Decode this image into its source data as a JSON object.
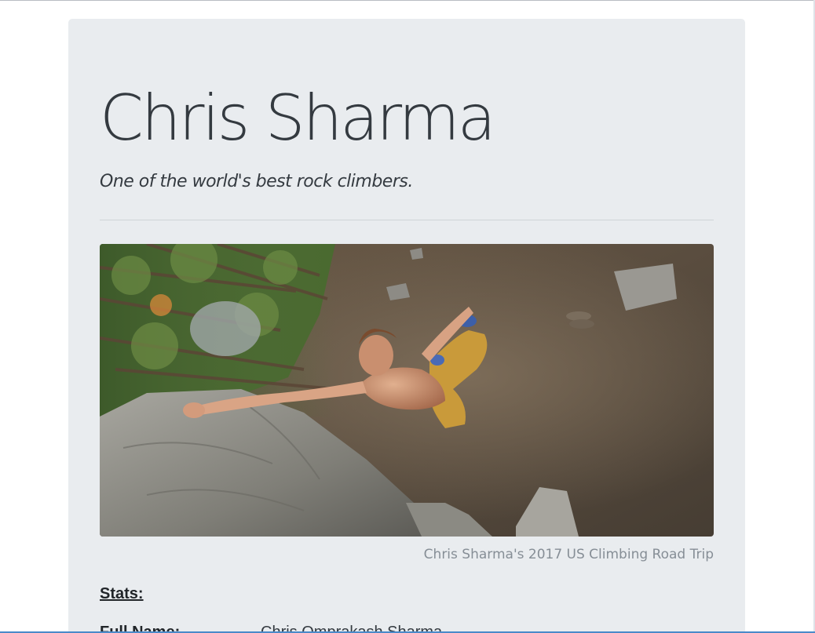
{
  "jumbotron": {
    "title": "Chris Sharma",
    "subtitle": "One of the world's best rock climbers.",
    "image_caption": "Chris Sharma's 2017 US Climbing Road Trip"
  },
  "stats": {
    "heading": "Stats:",
    "rows": [
      {
        "key": "Full Name:",
        "value": "Chris Omprakash Sharma"
      }
    ]
  },
  "colors": {
    "page_background": "#ffffff",
    "jumbotron_background": "#e9ecef",
    "title_text": "#343a40",
    "caption_text": "#868e96"
  }
}
